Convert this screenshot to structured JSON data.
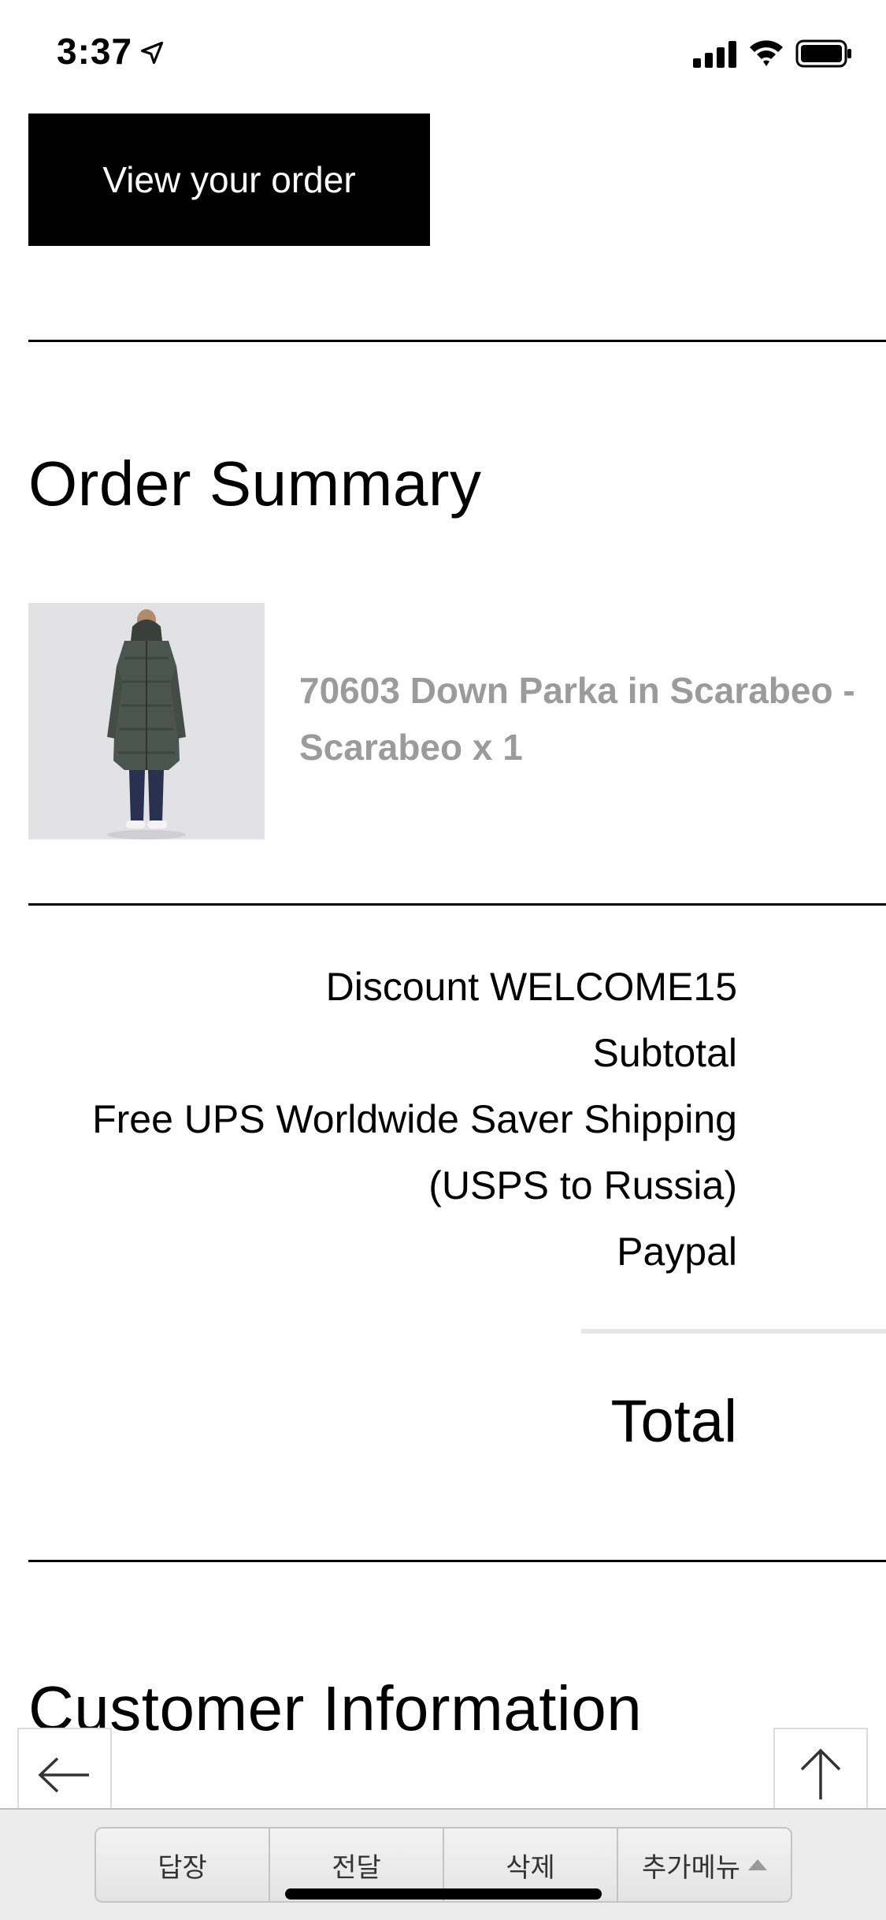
{
  "status_bar": {
    "time": "3:37"
  },
  "actions": {
    "view_order": "View your order"
  },
  "order_summary": {
    "title": "Order Summary",
    "product": {
      "name_line1": "70603 Down Parka in Scarabeo -",
      "name_line2": "Scarabeo x 1"
    },
    "lines": [
      "Discount WELCOME15",
      "Subtotal",
      "Free UPS Worldwide Saver Shipping",
      "(USPS to Russia)",
      "Paypal"
    ],
    "total_label": "Total"
  },
  "customer_information": {
    "title": "Customer Information"
  },
  "toolbar": {
    "items": [
      "답장",
      "전달",
      "삭제",
      "추가메뉴"
    ]
  },
  "icons": {
    "back": "arrow-left-icon",
    "top": "arrow-up-icon",
    "location": "location-arrow-icon",
    "signal": "cellular-signal-icon",
    "wifi": "wifi-icon",
    "battery": "battery-icon"
  }
}
